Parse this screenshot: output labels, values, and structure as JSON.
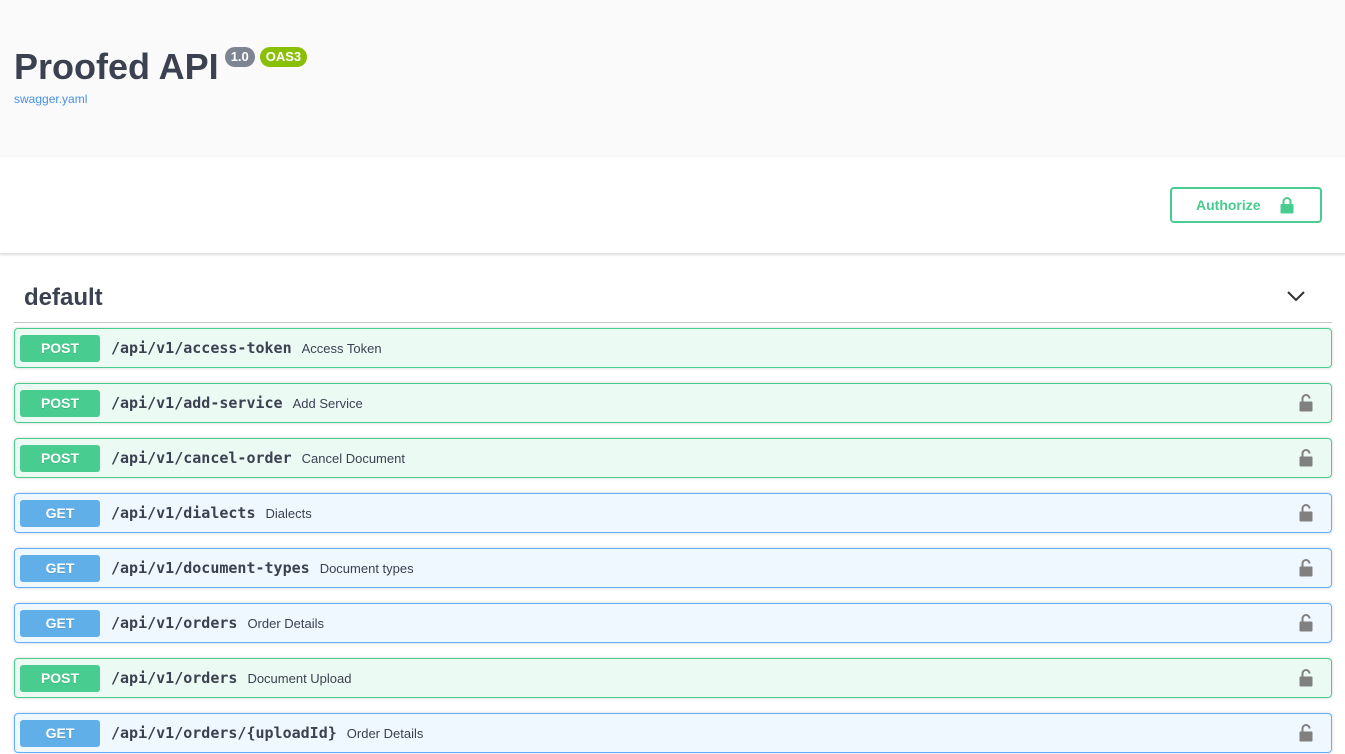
{
  "info": {
    "title": "Proofed API",
    "version": "1.0",
    "oas_badge": "OAS3",
    "spec_link": "swagger.yaml"
  },
  "scheme": {
    "authorize_label": "Authorize"
  },
  "tag": {
    "name": "default"
  },
  "operations": [
    {
      "method": "POST",
      "path": "/api/v1/access-token",
      "summary": "Access Token",
      "locked": false
    },
    {
      "method": "POST",
      "path": "/api/v1/add-service",
      "summary": "Add Service",
      "locked": true
    },
    {
      "method": "POST",
      "path": "/api/v1/cancel-order",
      "summary": "Cancel Document",
      "locked": true
    },
    {
      "method": "GET",
      "path": "/api/v1/dialects",
      "summary": "Dialects",
      "locked": true
    },
    {
      "method": "GET",
      "path": "/api/v1/document-types",
      "summary": "Document types",
      "locked": true
    },
    {
      "method": "GET",
      "path": "/api/v1/orders",
      "summary": "Order Details",
      "locked": true
    },
    {
      "method": "POST",
      "path": "/api/v1/orders",
      "summary": "Document Upload",
      "locked": true
    },
    {
      "method": "GET",
      "path": "/api/v1/orders/{uploadId}",
      "summary": "Order Details",
      "locked": true
    }
  ],
  "colors": {
    "post": "#49cc90",
    "get": "#61affe",
    "text": "#3b4151",
    "link": "#4990e2"
  },
  "icons": {
    "authorize": "lock-icon",
    "collapse": "chevron-down-icon",
    "operation_auth": "padlock-icon"
  }
}
